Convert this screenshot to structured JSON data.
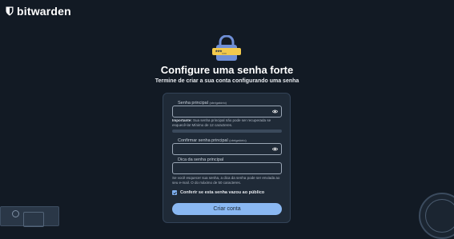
{
  "brand": {
    "name": "bitwarden",
    "icon": "shield-icon"
  },
  "header": {
    "title": "Configure uma senha forte",
    "subtitle": "Termine de criar a sua conta configurando uma senha"
  },
  "form": {
    "master_password": {
      "label": "Senha principal",
      "required": "(obrigatório)",
      "value": "",
      "icon": "eye-icon"
    },
    "important_note": {
      "lead": "Importante:",
      "text": " Sua senha principal não pode ser recuperada se esquecê-la! Mínimo de 12 caracteres."
    },
    "confirm_password": {
      "label": "Confirmar senha principal",
      "required": "(obrigatório)",
      "value": "",
      "icon": "eye-icon"
    },
    "hint": {
      "label": "Dica da senha principal",
      "value": "",
      "help": "Se você esquecer sua senha, a dica da senha pode ser enviada ao seu e-mail. O do máximo de 50 caracteres."
    },
    "breach_check": {
      "label": "Conferir se esta senha vazou ao público",
      "checked": true
    },
    "submit_label": "Criar conta"
  },
  "hero_icon": {
    "name": "padlock-password-icon",
    "mask": "***..."
  },
  "colors": {
    "background": "#121a24",
    "card": "#1f2a37",
    "accent": "#8ab8f2",
    "lock_body": "#f2c94c",
    "lock_shackle": "#6f8fd6"
  }
}
